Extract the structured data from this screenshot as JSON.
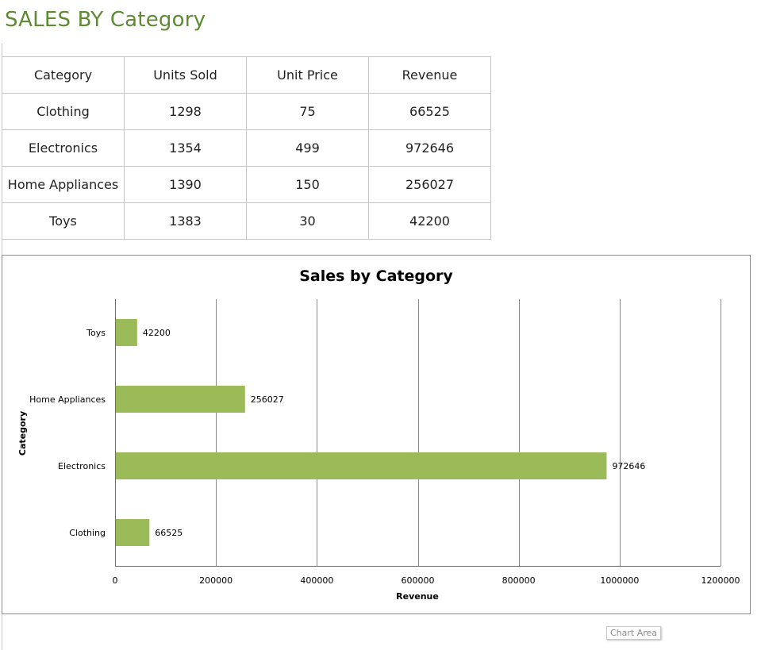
{
  "page": {
    "title": "SALES BY Category",
    "title_color": "#5e8a34"
  },
  "table": {
    "headers": [
      "Category",
      "Units Sold",
      "Unit Price",
      "Revenue"
    ],
    "rows": [
      [
        "Clothing",
        "1298",
        "75",
        "66525"
      ],
      [
        "Electronics",
        "1354",
        "499",
        "972646"
      ],
      [
        "Home Appliances",
        "1390",
        "150",
        "256027"
      ],
      [
        "Toys",
        "1383",
        "30",
        "42200"
      ]
    ]
  },
  "chart_data": {
    "type": "bar",
    "orientation": "horizontal",
    "title": "Sales by Category",
    "xlabel": "Revenue",
    "ylabel": "Category",
    "categories": [
      "Clothing",
      "Electronics",
      "Home Appliances",
      "Toys"
    ],
    "values": [
      66525,
      972646,
      256027,
      42200
    ],
    "xlim": [
      0,
      1200000
    ],
    "x_ticks": [
      "0",
      "200000",
      "400000",
      "600000",
      "800000",
      "1000000",
      "1200000"
    ],
    "data_labels": [
      "66525",
      "972646",
      "256027",
      "42200"
    ],
    "grid": "vertical",
    "legend": "none",
    "bar_color": "#9bbb59"
  },
  "tooltip": {
    "text": "Chart Area"
  }
}
